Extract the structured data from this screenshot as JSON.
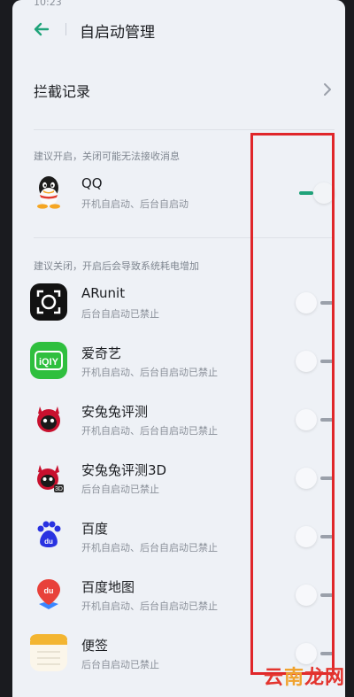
{
  "status": {
    "time": "10:23"
  },
  "header": {
    "title": "自启动管理"
  },
  "intercept_log": {
    "label": "拦截记录"
  },
  "sections": {
    "recommend_on": "建议开启，关闭可能无法接收消息",
    "recommend_off": "建议关闭，开启后会导致系统耗电增加"
  },
  "apps": [
    {
      "name": "QQ",
      "status": "开机自启动、后台自启动",
      "enabled": true
    },
    {
      "name": "ARunit",
      "status": "后台自启动已禁止",
      "enabled": false
    },
    {
      "name": "爱奇艺",
      "status": "开机自启动、后台自启动已禁止",
      "enabled": false
    },
    {
      "name": "安兔兔评测",
      "status": "开机自启动、后台自启动已禁止",
      "enabled": false
    },
    {
      "name": "安兔兔评测3D",
      "status": "后台自启动已禁止",
      "enabled": false
    },
    {
      "name": "百度",
      "status": "开机自启动、后台自启动已禁止",
      "enabled": false
    },
    {
      "name": "百度地图",
      "status": "开机自启动、后台自启动已禁止",
      "enabled": false
    },
    {
      "name": "便签",
      "status": "后台自启动已禁止",
      "enabled": false
    }
  ],
  "icons": {
    "back": "arrow-left-icon",
    "chevron": "chevron-right-icon"
  },
  "colors": {
    "accent": "#1fa37a",
    "highlight": "#e0262a"
  },
  "watermark": {
    "part1": "云",
    "part2": "南",
    "part3": "龙网"
  }
}
